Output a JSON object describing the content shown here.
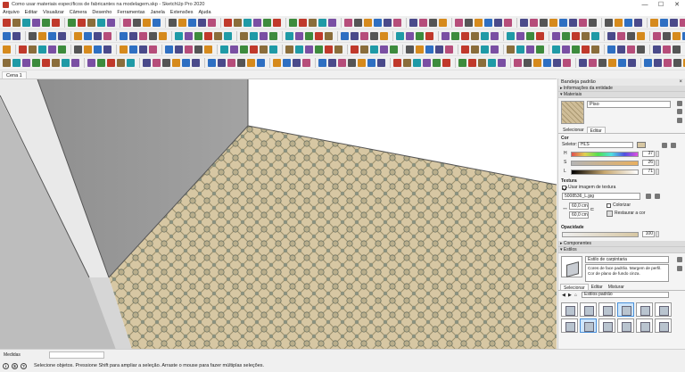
{
  "window": {
    "title": "Como usar materiais específicos de fabricantes na modelagem.skp - SketchUp Pro 2020",
    "controls": [
      "—",
      "☐",
      "✕"
    ]
  },
  "menu": [
    "Arquivo",
    "Editar",
    "Visualizar",
    "Câmera",
    "Desenho",
    "Ferramentas",
    "Janela",
    "Extensões",
    "Ajuda"
  ],
  "tag_selector": {
    "value": "Sem etiquetas"
  },
  "scene_tab": "Cena 1",
  "tray": {
    "title": "Bandeja padrão",
    "entity_info": "Informações da entidade",
    "materials_title": "Materiais",
    "material_name": "Piso",
    "tabs": [
      "Selecionar",
      "Editar"
    ],
    "active_tab": "Editar",
    "color_label": "Cor",
    "picker_label": "Seletor:",
    "picker_value": "HLS",
    "h_label": "H",
    "s_label": "S",
    "l_label": "L",
    "h": "37",
    "s": "26",
    "l": "71",
    "texture_label": "Textura",
    "use_texture": "Usar imagem de textura",
    "texture_file": "5008536_L.jpg",
    "width": "60,0 cm",
    "height": "60,0 cm",
    "colorize": "Colorizar",
    "reset_color": "Restaurar a cor",
    "opacity_label": "Opacidade",
    "opacity": "100",
    "components": "Componentes",
    "styles": "Estilos",
    "style_name": "Estilo de carpintaria",
    "style_desc": "Cores de face padrão. Margem de perfil. Cor de plano de fundo cinza.",
    "style_tabs": [
      "Selecionar",
      "Editar",
      "Misturar"
    ],
    "style_active": "Selecionar",
    "style_collection": "Estilos padrão"
  },
  "measurements": {
    "label": "Medidas"
  },
  "status": {
    "text": "Selecione objetos. Pressione Shift para ampliar a seleção. Arraste o mouse para fazer múltiplas seleções."
  },
  "colors": {
    "floor_tile": "#d7c7a3",
    "wall_shadow": "#9d9d9d",
    "wall_light": "#f4f4f4",
    "toolbar_bg": "#f0f0f0"
  }
}
